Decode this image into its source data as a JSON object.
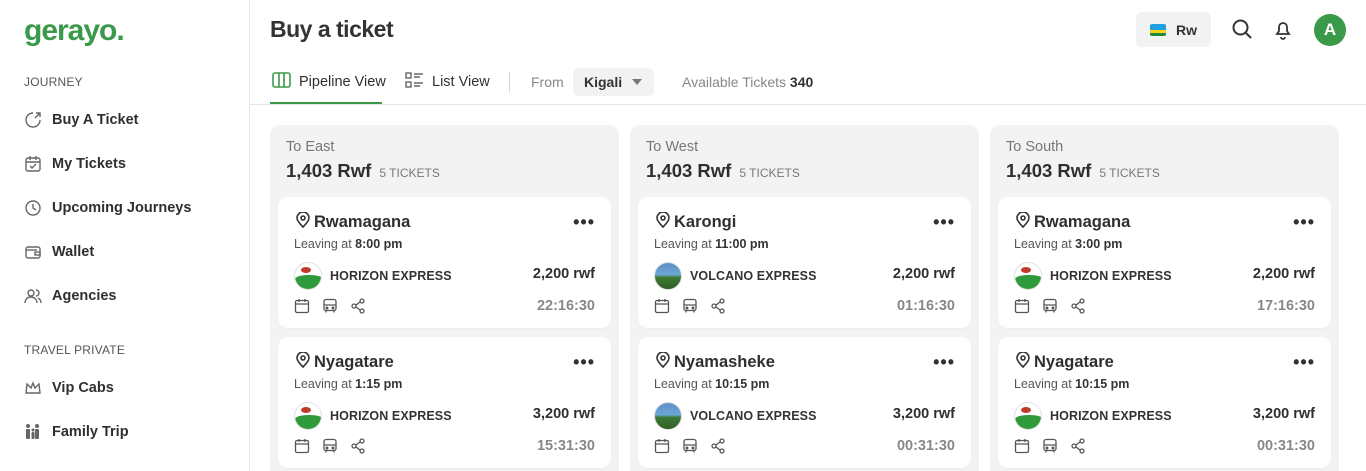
{
  "sidebar": {
    "logo": "gerayo.",
    "journey_label": "JOURNEY",
    "journey_items": [
      {
        "label": "Buy A Ticket",
        "icon": "ticket-icon"
      },
      {
        "label": "My Tickets",
        "icon": "calendar-check-icon"
      },
      {
        "label": "Upcoming Journeys",
        "icon": "clock-icon"
      },
      {
        "label": "Wallet",
        "icon": "wallet-icon"
      },
      {
        "label": "Agencies",
        "icon": "users-icon"
      }
    ],
    "private_label": "TRAVEL PRIVATE",
    "private_items": [
      {
        "label": "Vip Cabs",
        "icon": "crown-icon"
      },
      {
        "label": "Family Trip",
        "icon": "family-icon"
      }
    ]
  },
  "header": {
    "title": "Buy a ticket",
    "language": "Rw"
  },
  "avatar_initial": "A",
  "tabs": {
    "pipeline": "Pipeline View",
    "list": "List View"
  },
  "filter": {
    "from_label": "From",
    "from_value": "Kigali",
    "available_label": "Available Tickets",
    "available_count": "340"
  },
  "columns": [
    {
      "title": "To East",
      "amount": "1,403 Rwf",
      "count": "5 TICKETS",
      "cards": [
        {
          "dest": "Rwamagana",
          "leave_prefix": "Leaving at",
          "leave_time": "8:00 pm",
          "company": "HORIZON EXPRESS",
          "logo": "horizon",
          "price": "2,200 rwf",
          "countdown": "22:16:30"
        },
        {
          "dest": "Nyagatare",
          "leave_prefix": "Leaving at",
          "leave_time": "1:15 pm",
          "company": "HORIZON EXPRESS",
          "logo": "horizon",
          "price": "3,200 rwf",
          "countdown": "15:31:30"
        }
      ]
    },
    {
      "title": "To West",
      "amount": "1,403 Rwf",
      "count": "5 TICKETS",
      "cards": [
        {
          "dest": "Karongi",
          "leave_prefix": "Leaving at",
          "leave_time": "11:00 pm",
          "company": "VOLCANO EXPRESS",
          "logo": "volcano",
          "price": "2,200 rwf",
          "countdown": "01:16:30"
        },
        {
          "dest": "Nyamasheke",
          "leave_prefix": "Leaving at",
          "leave_time": "10:15 pm",
          "company": "VOLCANO EXPRESS",
          "logo": "volcano",
          "price": "3,200 rwf",
          "countdown": "00:31:30"
        }
      ]
    },
    {
      "title": "To South",
      "amount": "1,403 Rwf",
      "count": "5 TICKETS",
      "cards": [
        {
          "dest": "Rwamagana",
          "leave_prefix": "Leaving at",
          "leave_time": "3:00 pm",
          "company": "HORIZON EXPRESS",
          "logo": "horizon",
          "price": "2,200 rwf",
          "countdown": "17:16:30"
        },
        {
          "dest": "Nyagatare",
          "leave_prefix": "Leaving at",
          "leave_time": "10:15 pm",
          "company": "HORIZON EXPRESS",
          "logo": "horizon",
          "price": "3,200 rwf",
          "countdown": "00:31:30"
        }
      ]
    }
  ],
  "colors": {
    "brand": "#3a9a4a",
    "column_bg": "#f3f3f3",
    "muted": "#888888"
  }
}
